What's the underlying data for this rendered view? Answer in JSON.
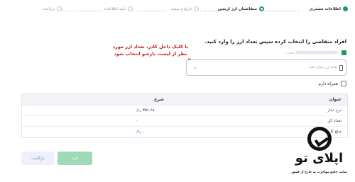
{
  "stepper": {
    "steps": [
      {
        "label": "اطلاعات مشتری",
        "state": "done"
      },
      {
        "label": "متقاضیان ارز اربعین",
        "state": "active"
      },
      {
        "label": "تاریخ و شعبه",
        "state": "pending"
      },
      {
        "label": "تایید اطلاعات",
        "state": "pending"
      },
      {
        "label": "پرداخت",
        "state": "pending"
      }
    ]
  },
  "form": {
    "title": "افراد متقاضی را انتخاب کرده سپس تعداد ارز را وارد کنید.",
    "person_suffix": "نیست)",
    "select_placeholder": "تعداد ارز را وارد کنید...",
    "companion_label": "همراه دارم"
  },
  "annotation": {
    "line1": "با کلیک داخل کادر، تعداد ارز مورد",
    "line2": "نظر از لیست بازشو انتخاب شود"
  },
  "table": {
    "headers": {
      "title": "عنوان",
      "description": "شرح"
    },
    "rows": [
      {
        "title": "نرخ دینار",
        "value": "۳۵۶.۶۸",
        "unit": "ریال",
        "link": false
      },
      {
        "title": "تعداد کل",
        "value": "۰",
        "unit": "",
        "link": false
      },
      {
        "title": "مبلغ کل",
        "value": "۰",
        "unit": "ریال",
        "link": true
      }
    ]
  },
  "buttons": {
    "confirm": "تایید",
    "back": "بازگشت"
  },
  "logo": {
    "wordmark": "اپلای تو",
    "tagline": "سایت جامع مهاجرت به خارج از کشور"
  },
  "colors": {
    "accent": "#1e9e5a",
    "confirm_bg": "#9fd9b6",
    "annotation": "#c4161c",
    "link": "#2f63d6"
  }
}
